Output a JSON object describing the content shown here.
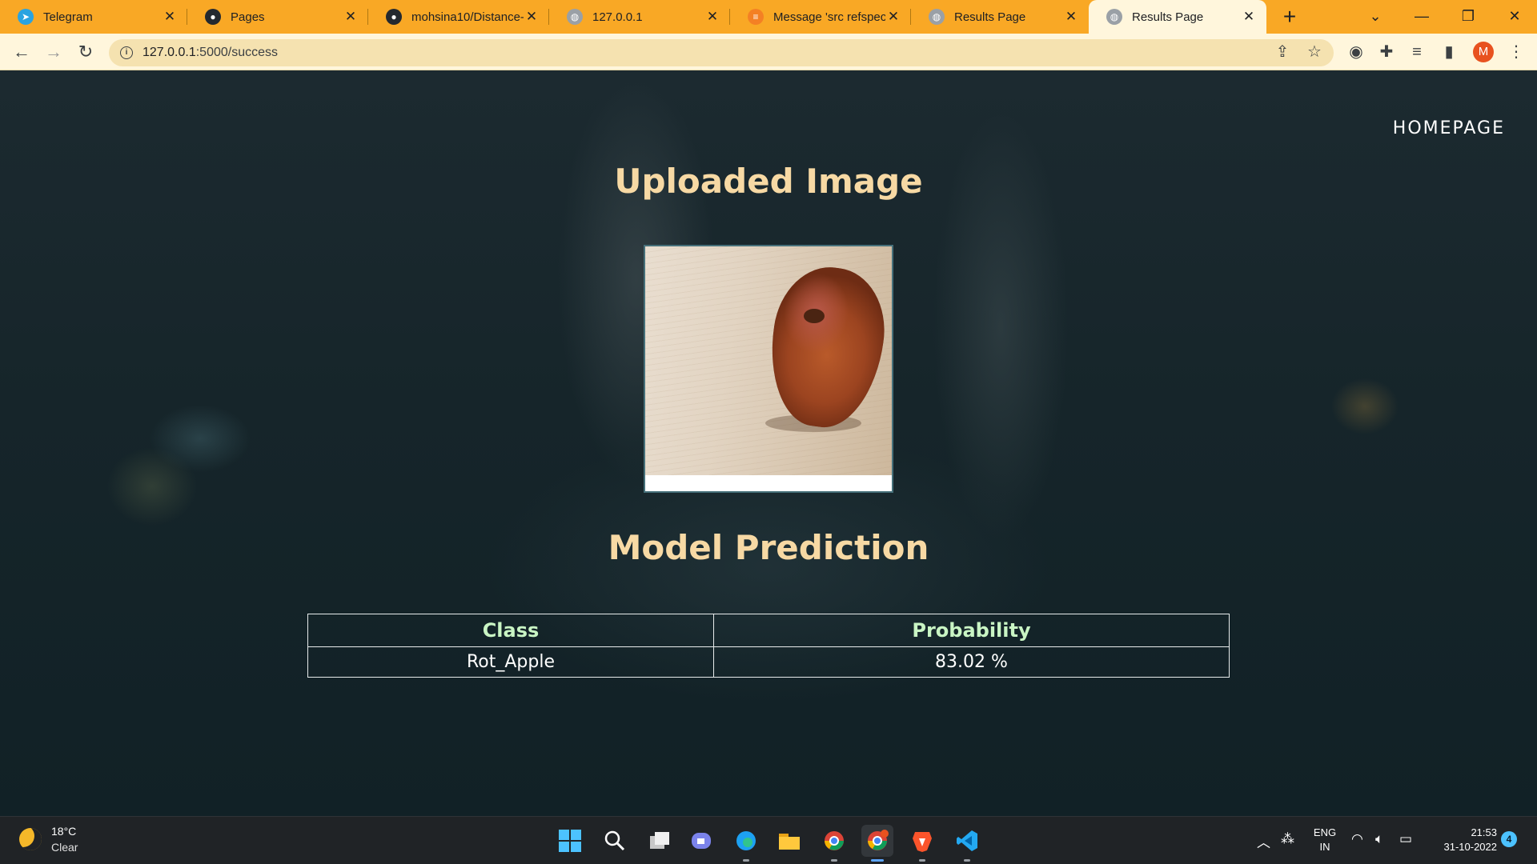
{
  "browser": {
    "tabs": [
      {
        "title": "Telegram",
        "icon": "telegram-icon",
        "color": "#2aa3e0"
      },
      {
        "title": "Pages",
        "icon": "github-icon",
        "color": "#24292f"
      },
      {
        "title": "mohsina10/Distance-",
        "icon": "github-icon",
        "color": "#24292f"
      },
      {
        "title": "127.0.0.1",
        "icon": "globe-icon",
        "color": "#9aa0a6"
      },
      {
        "title": "Message 'src refspec",
        "icon": "stackoverflow-icon",
        "color": "#f48024"
      },
      {
        "title": "Results Page",
        "icon": "globe-icon",
        "color": "#9aa0a6"
      },
      {
        "title": "Results Page",
        "icon": "globe-icon",
        "color": "#9aa0a6",
        "active": true
      }
    ],
    "new_tab_label": "+",
    "url_host": "127.0.0.1",
    "url_path": ":5000/success",
    "avatar_letter": "M"
  },
  "page": {
    "nav_link": "HOMEPAGE",
    "uploaded_heading": "Uploaded Image",
    "prediction_heading": "Model Prediction",
    "table": {
      "headers": [
        "Class",
        "Probability"
      ],
      "rows": [
        [
          "Rot_Apple",
          "83.02 %"
        ]
      ]
    },
    "colors": {
      "heading": "#f7d9a4",
      "table_header": "#c9f5c4",
      "tab_strip": "#f9a825"
    }
  },
  "taskbar": {
    "weather_temp": "18°C",
    "weather_condition": "Clear",
    "language": "ENG",
    "region": "IN",
    "time": "21:53",
    "date": "31-10-2022",
    "notification_count": "4"
  }
}
